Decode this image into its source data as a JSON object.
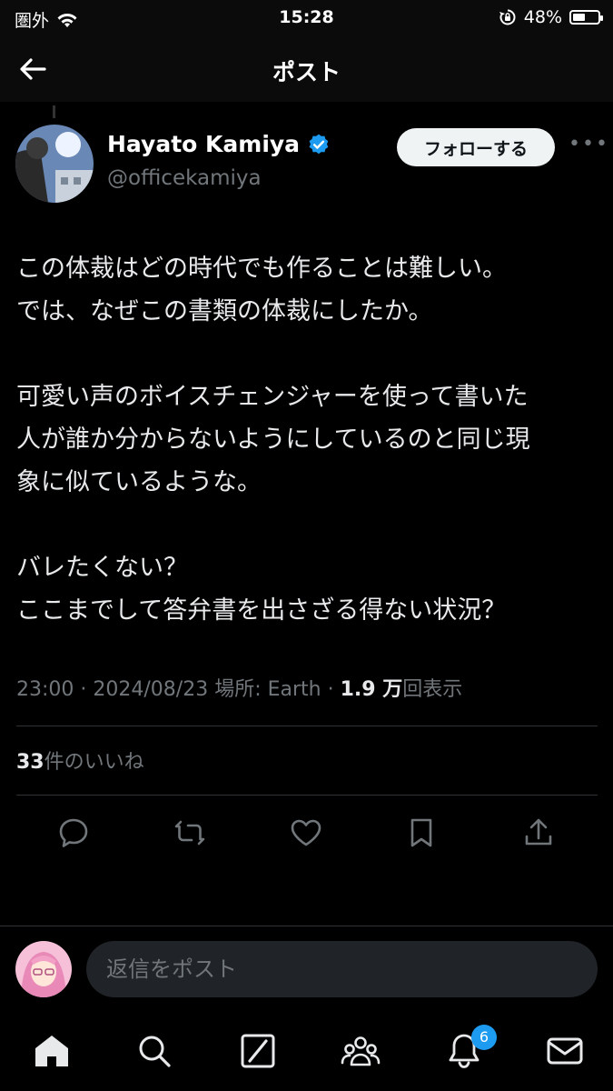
{
  "status_bar": {
    "carrier": "圏外",
    "time": "15:28",
    "battery_percent": "48%",
    "battery_level": 0.48
  },
  "header": {
    "title": "ポスト"
  },
  "author": {
    "name": "Hayato Kamiya",
    "handle": "@officekamiya",
    "verified": true,
    "follow_label": "フォローする"
  },
  "post": {
    "lines": [
      "この体裁はどの時代でも作ることは難しい。",
      "では、なぜこの書類の体裁にしたか。",
      "",
      "可愛い声のボイスチェンジャーを使って書いた",
      "人が誰か分からないようにしているのと同じ現",
      "象に似ているような。",
      "",
      "バレたくない？",
      "ここまでして答弁書を出さざる得ない状況？"
    ],
    "time": "23:00",
    "date": "2024/08/23",
    "location_label": "場所: Earth",
    "views_count": "1.9 万",
    "views_label": "回表示",
    "likes_count": "33",
    "likes_label": "件のいいね"
  },
  "reply": {
    "placeholder": "返信をポスト"
  },
  "nav": {
    "notifications_badge": "6"
  },
  "colors": {
    "accent": "#1d9bf0",
    "background": "#000000",
    "muted": "#71767b",
    "text": "#e7e9ea"
  }
}
